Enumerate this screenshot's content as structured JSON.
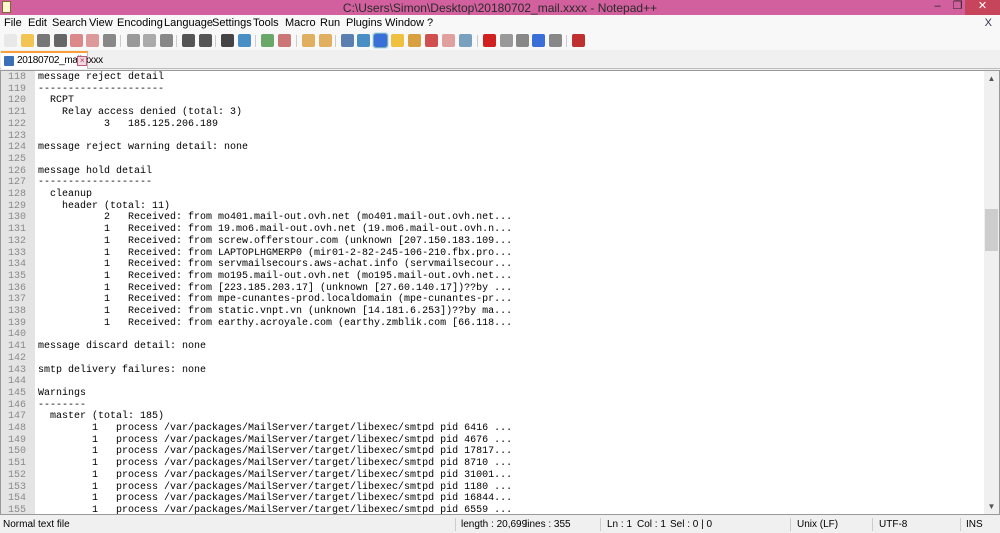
{
  "window": {
    "title": "C:\\Users\\Simon\\Desktop\\20180702_mail.xxxx - Notepad++",
    "minimize": "–",
    "maximize": "❐",
    "close": "✕"
  },
  "menu": [
    "File",
    "Edit",
    "Search",
    "View",
    "Encoding",
    "Language",
    "Settings",
    "Tools",
    "Macro",
    "Run",
    "Plugins",
    "Window",
    "?"
  ],
  "menu_close": "X",
  "toolbar": [
    {
      "name": "new-file-icon",
      "color": "#e8e8e8"
    },
    {
      "name": "open-file-icon",
      "color": "#f1c453"
    },
    {
      "name": "save-icon",
      "color": "#777"
    },
    {
      "name": "save-all-icon",
      "color": "#666"
    },
    {
      "name": "close-icon",
      "color": "#d88"
    },
    {
      "name": "close-all-icon",
      "color": "#d99"
    },
    {
      "name": "print-icon",
      "color": "#888"
    },
    {
      "name": "cut-icon",
      "color": "#999"
    },
    {
      "name": "copy-icon",
      "color": "#aaa"
    },
    {
      "name": "paste-icon",
      "color": "#888"
    },
    {
      "name": "undo-icon",
      "color": "#555"
    },
    {
      "name": "redo-icon",
      "color": "#555"
    },
    {
      "name": "find-icon",
      "color": "#444"
    },
    {
      "name": "replace-icon",
      "color": "#4a8ec6"
    },
    {
      "name": "zoom-in-icon",
      "color": "#6aa86a"
    },
    {
      "name": "zoom-out-icon",
      "color": "#c77"
    },
    {
      "name": "sync-vertical-icon",
      "color": "#e0b060"
    },
    {
      "name": "sync-horizontal-icon",
      "color": "#e0b060"
    },
    {
      "name": "word-wrap-icon",
      "color": "#5b7fb0"
    },
    {
      "name": "show-all-characters-icon",
      "color": "#4a8ec6"
    },
    {
      "name": "indent-guide-icon",
      "color": "#3a6fd8"
    },
    {
      "name": "user-defined-language-icon",
      "color": "#f0c040"
    },
    {
      "name": "document-map-icon",
      "color": "#d8a040"
    },
    {
      "name": "function-list-icon",
      "color": "#d05050"
    },
    {
      "name": "folder-workspace-icon",
      "color": "#e0a0a0"
    },
    {
      "name": "monitoring-icon",
      "color": "#7aa0c0"
    },
    {
      "name": "record-macro-icon",
      "color": "#d02020"
    },
    {
      "name": "stop-macro-icon",
      "color": "#999"
    },
    {
      "name": "play-macro-icon",
      "color": "#888"
    },
    {
      "name": "play-macro-multiple-icon",
      "color": "#3a6fd8"
    },
    {
      "name": "save-macro-icon",
      "color": "#888"
    },
    {
      "name": "spell-check-icon",
      "color": "#c03030"
    }
  ],
  "tab": {
    "label": "20180702_mail.xxxx",
    "close": "×"
  },
  "editor": {
    "lines": [
      {
        "n": "118",
        "t": "message reject detail"
      },
      {
        "n": "119",
        "t": "---------------------"
      },
      {
        "n": "120",
        "t": "  RCPT"
      },
      {
        "n": "121",
        "t": "    Relay access denied (total: 3)"
      },
      {
        "n": "122",
        "t": "           3   185.125.206.189"
      },
      {
        "n": "123",
        "t": ""
      },
      {
        "n": "124",
        "t": "message reject warning detail: none"
      },
      {
        "n": "125",
        "t": ""
      },
      {
        "n": "126",
        "t": "message hold detail"
      },
      {
        "n": "127",
        "t": "-------------------"
      },
      {
        "n": "128",
        "t": "  cleanup"
      },
      {
        "n": "129",
        "t": "    header (total: 11)"
      },
      {
        "n": "130",
        "t": "           2   Received: from mo401.mail-out.ovh.net (mo401.mail-out.ovh.net..."
      },
      {
        "n": "131",
        "t": "           1   Received: from 19.mo6.mail-out.ovh.net (19.mo6.mail-out.ovh.n..."
      },
      {
        "n": "132",
        "t": "           1   Received: from screw.offerstour.com (unknown [207.150.183.109..."
      },
      {
        "n": "133",
        "t": "           1   Received: from LAPTOPLHGMERP0 (mir01-2-82-245-106-210.fbx.pro..."
      },
      {
        "n": "134",
        "t": "           1   Received: from servmailsecours.aws-achat.info (servmailsecour..."
      },
      {
        "n": "135",
        "t": "           1   Received: from mo195.mail-out.ovh.net (mo195.mail-out.ovh.net..."
      },
      {
        "n": "136",
        "t": "           1   Received: from [223.185.203.17] (unknown [27.60.140.17])??by ..."
      },
      {
        "n": "137",
        "t": "           1   Received: from mpe-cunantes-prod.localdomain (mpe-cunantes-pr..."
      },
      {
        "n": "138",
        "t": "           1   Received: from static.vnpt.vn (unknown [14.181.6.253])??by ma..."
      },
      {
        "n": "139",
        "t": "           1   Received: from earthy.acroyale.com (earthy.zmblik.com [66.118..."
      },
      {
        "n": "140",
        "t": ""
      },
      {
        "n": "141",
        "t": "message discard detail: none"
      },
      {
        "n": "142",
        "t": ""
      },
      {
        "n": "143",
        "t": "smtp delivery failures: none"
      },
      {
        "n": "144",
        "t": ""
      },
      {
        "n": "145",
        "t": "Warnings"
      },
      {
        "n": "146",
        "t": "--------"
      },
      {
        "n": "147",
        "t": "  master (total: 185)"
      },
      {
        "n": "148",
        "t": "         1   process /var/packages/MailServer/target/libexec/smtpd pid 6416 ..."
      },
      {
        "n": "149",
        "t": "         1   process /var/packages/MailServer/target/libexec/smtpd pid 4676 ..."
      },
      {
        "n": "150",
        "t": "         1   process /var/packages/MailServer/target/libexec/smtpd pid 17817..."
      },
      {
        "n": "151",
        "t": "         1   process /var/packages/MailServer/target/libexec/smtpd pid 8710 ..."
      },
      {
        "n": "152",
        "t": "         1   process /var/packages/MailServer/target/libexec/smtpd pid 31001..."
      },
      {
        "n": "153",
        "t": "         1   process /var/packages/MailServer/target/libexec/smtpd pid 1180 ..."
      },
      {
        "n": "154",
        "t": "         1   process /var/packages/MailServer/target/libexec/smtpd pid 16844..."
      },
      {
        "n": "155",
        "t": "         1   process /var/packages/MailServer/target/libexec/smtpd pid 6559 ..."
      }
    ]
  },
  "scrollbar": {
    "up": "▲",
    "down": "▼",
    "position_fraction": 0.33
  },
  "status": {
    "type": "Normal text file",
    "length": "length : 20,699",
    "lines": "lines : 355",
    "ln": "Ln : 1",
    "col": "Col : 1",
    "sel": "Sel : 0 | 0",
    "eol": "Unix (LF)",
    "encoding": "UTF-8",
    "mode": "INS"
  }
}
